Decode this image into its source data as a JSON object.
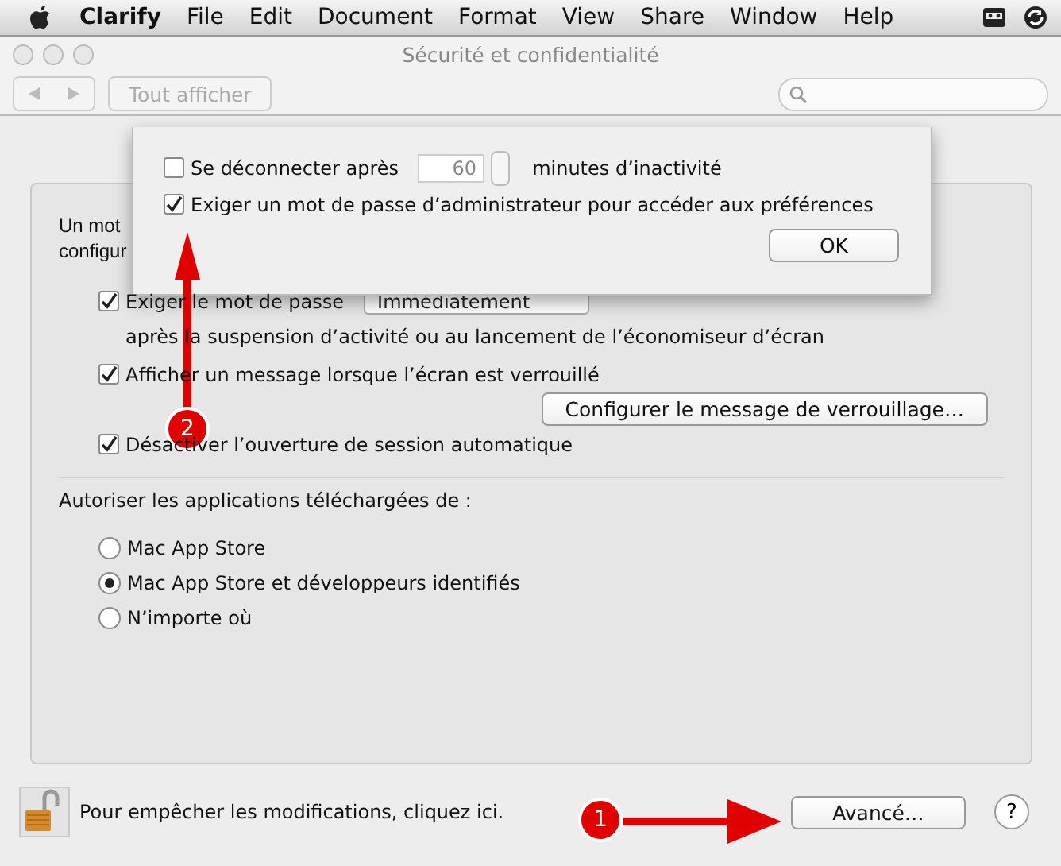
{
  "menubar": {
    "app": "Clarify",
    "menus": [
      "File",
      "Edit",
      "Document",
      "Format",
      "View",
      "Share",
      "Window",
      "Help"
    ]
  },
  "window": {
    "title": "Sécurité et confidentialité"
  },
  "toolbar": {
    "show_all": "Tout afficher"
  },
  "password_intro": [
    "Un mot",
    "configur"
  ],
  "options": [
    {
      "kind": "checkbox",
      "label": "Exiger le mot de passe",
      "checked": true,
      "popup": "Immédiatement"
    },
    {
      "kind": "note",
      "label": "après la suspension d’activité ou au lancement de l’économiseur d’écran"
    },
    {
      "kind": "checkbox",
      "label": "Afficher un message lorsque l’écran est verrouillé",
      "checked": true
    },
    {
      "kind": "button",
      "label": "Configurer le message de verrouillage…"
    },
    {
      "kind": "checkbox",
      "label": "Désactiver l’ouverture de session automatique",
      "checked": true
    }
  ],
  "downloads": {
    "label": "Autoriser les applications téléchargées de :",
    "options": [
      {
        "label": "Mac App Store",
        "selected": false
      },
      {
        "label": "Mac App Store et développeurs identifiés",
        "selected": true
      },
      {
        "label": "N’importe où",
        "selected": false
      }
    ]
  },
  "footer": {
    "lock_text": "Pour empêcher les modifications, cliquez ici.",
    "advanced": "Avancé…",
    "help": "?"
  },
  "sheet": {
    "logout": {
      "checked": false,
      "label": "Se déconnecter après",
      "minutes": "60",
      "unit": "minutes d’inactivité"
    },
    "admin": {
      "checked": true,
      "label": "Exiger un mot de passe d’administrateur pour accéder aux préférences"
    },
    "ok": "OK"
  },
  "annotations": [
    {
      "number": "1"
    },
    {
      "number": "2"
    }
  ]
}
